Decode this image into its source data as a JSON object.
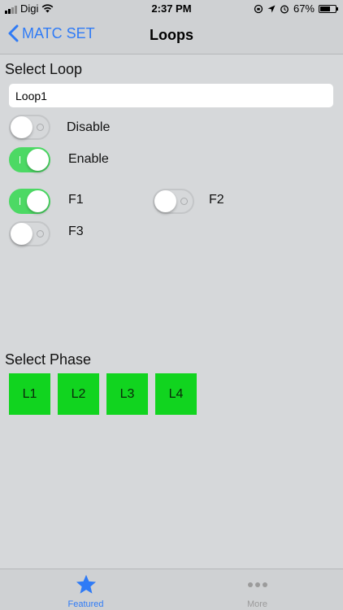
{
  "status_bar": {
    "carrier": "Digi",
    "time": "2:37 PM",
    "battery": "67%",
    "battery_level": 0.67
  },
  "nav": {
    "back_label": "MATC SET",
    "title": "Loops"
  },
  "loop_section": {
    "label": "Select Loop",
    "input_value": "Loop1"
  },
  "switches": {
    "disable": {
      "label": "Disable",
      "on": false
    },
    "enable": {
      "label": "Enable",
      "on": true
    },
    "f1": {
      "label": "F1",
      "on": true
    },
    "f2": {
      "label": "F2",
      "on": false
    },
    "f3": {
      "label": "F3",
      "on": false
    }
  },
  "phase_section": {
    "label": "Select Phase",
    "buttons": [
      "L1",
      "L2",
      "L3",
      "L4"
    ]
  },
  "tab_bar": {
    "tabs": [
      {
        "label": "Featured",
        "icon": "star-icon",
        "active": true
      },
      {
        "label": "More",
        "icon": "more-icon",
        "active": false
      }
    ]
  },
  "colors": {
    "accent": "#2f7bf6",
    "switch_on": "#4cd964",
    "phase_button": "#11d41f",
    "inactive_tab": "#9b9b9b"
  }
}
